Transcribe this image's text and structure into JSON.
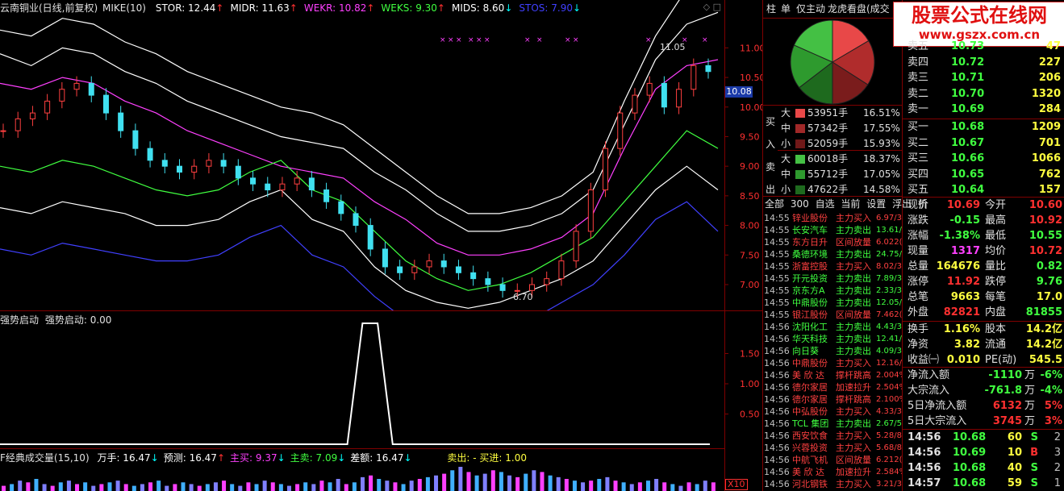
{
  "main_chart": {
    "stock": "云南铜业(日线,前复权)",
    "indicator": "MIKE(10)",
    "legend": [
      {
        "label": "STOR: 12.44",
        "color": "#ffffff",
        "arrow": "↑",
        "arrow_color": "#ff3030"
      },
      {
        "label": "MIDR: 11.63",
        "color": "#ffffff",
        "arrow": "↑",
        "arrow_color": "#ff3030"
      },
      {
        "label": "WEKR: 10.82",
        "color": "#ff40ff",
        "arrow": "↑",
        "arrow_color": "#ff3030"
      },
      {
        "label": "WEKS: 9.30",
        "color": "#40ff40",
        "arrow": "↑",
        "arrow_color": "#ff3030"
      },
      {
        "label": "MIDS: 8.60",
        "color": "#ffffff",
        "arrow": "↓",
        "arrow_color": "#00ffff"
      },
      {
        "label": "STOS: 7.90",
        "color": "#4040ff",
        "arrow": "↓",
        "arrow_color": "#00ffff"
      }
    ],
    "y_ticks": [
      "11.00",
      "10.50",
      "10.00",
      "9.50",
      "9.00",
      "8.50",
      "8.00",
      "7.50",
      "7.00"
    ],
    "current_price_tag": "10.08",
    "high_label": "11.05",
    "low_label": "6.70"
  },
  "chart_data": [
    {
      "type": "line",
      "title": "",
      "series": [
        {
          "name": "STOR",
          "values": [
            11.3,
            11.2,
            11.5,
            11.4,
            11.1,
            10.9,
            10.6,
            10.4,
            10.2,
            10.0,
            9.9,
            9.7,
            9.3,
            8.9,
            8.5,
            8.2,
            8.2,
            8.3,
            8.5,
            8.9,
            10.1,
            11.2,
            12.0,
            12.4
          ]
        },
        {
          "name": "MIDR",
          "values": [
            10.9,
            10.7,
            11.0,
            10.9,
            10.6,
            10.4,
            10.1,
            9.9,
            9.7,
            9.5,
            9.4,
            9.3,
            8.9,
            8.6,
            8.2,
            7.9,
            7.9,
            8.0,
            8.2,
            8.6,
            9.7,
            10.8,
            11.4,
            11.6
          ]
        },
        {
          "name": "WEKR",
          "values": [
            10.4,
            10.3,
            10.5,
            10.4,
            10.1,
            9.9,
            9.6,
            9.4,
            9.2,
            9.0,
            8.9,
            8.8,
            8.4,
            8.1,
            7.7,
            7.5,
            7.5,
            7.6,
            7.8,
            8.2,
            9.3,
            10.3,
            10.7,
            10.8
          ]
        },
        {
          "name": "WEKS",
          "values": [
            9.0,
            8.9,
            9.1,
            9.0,
            8.8,
            8.6,
            8.5,
            8.6,
            8.9,
            9.1,
            8.6,
            8.4,
            7.9,
            7.4,
            7.1,
            6.9,
            7.0,
            7.2,
            7.5,
            7.8,
            8.4,
            9.0,
            9.6,
            9.3
          ]
        },
        {
          "name": "MIDS",
          "values": [
            8.3,
            8.2,
            8.4,
            8.3,
            8.2,
            8.0,
            8.0,
            8.1,
            8.4,
            8.6,
            8.1,
            7.9,
            7.3,
            6.9,
            6.7,
            6.6,
            6.7,
            6.9,
            7.1,
            7.4,
            8.0,
            8.6,
            9.0,
            8.6
          ]
        },
        {
          "name": "STOS",
          "values": [
            7.6,
            7.5,
            7.7,
            7.6,
            7.5,
            7.4,
            7.4,
            7.5,
            7.8,
            8.0,
            7.5,
            7.3,
            6.8,
            6.4,
            6.2,
            6.1,
            6.2,
            6.4,
            6.7,
            7.0,
            7.5,
            8.1,
            8.4,
            7.9
          ]
        }
      ],
      "candles": [
        9.6,
        9.8,
        9.9,
        10.1,
        10.3,
        10.4,
        10.2,
        9.9,
        9.6,
        9.3,
        9.1,
        9.0,
        8.9,
        9.0,
        9.1,
        9.0,
        8.8,
        8.7,
        8.6,
        8.7,
        8.8,
        8.6,
        8.4,
        8.2,
        8.0,
        7.6,
        7.3,
        7.2,
        7.3,
        7.4,
        7.3,
        7.2,
        7.1,
        7.0,
        6.9,
        6.9,
        7.0,
        7.1,
        7.4,
        7.9,
        8.6,
        9.3,
        9.9,
        10.2,
        10.4,
        10.0,
        10.3,
        10.7,
        10.6
      ],
      "ylim": [
        6.7,
        11.4
      ]
    },
    {
      "type": "line",
      "title": "",
      "series": [
        {
          "name": "强势启动",
          "values": [
            0,
            0,
            0,
            0,
            0,
            0,
            0,
            0,
            0,
            0,
            0,
            0,
            0,
            0,
            0,
            0,
            0,
            0,
            0,
            0,
            0,
            0,
            0,
            0,
            2,
            2,
            0,
            0,
            0,
            0,
            0,
            0,
            0,
            0,
            0,
            0,
            0,
            0,
            0,
            0,
            0,
            0,
            0,
            0,
            0,
            0,
            0,
            0
          ]
        }
      ],
      "ylim": [
        0,
        2.0
      ]
    },
    {
      "type": "bar",
      "title": "",
      "series": [
        {
          "name": "万手",
          "values": [
            3,
            4,
            6,
            5,
            7,
            4,
            3,
            5,
            6,
            4,
            5,
            3,
            4,
            5,
            6,
            4,
            3,
            4,
            5,
            6,
            3,
            4,
            5,
            4,
            3,
            4,
            5,
            6,
            4,
            3,
            5,
            4,
            6,
            5,
            4,
            3,
            4,
            5,
            4,
            6,
            5,
            7,
            4,
            5,
            8,
            9,
            7,
            6,
            5,
            4,
            6,
            7,
            8,
            9,
            10,
            12,
            14,
            11,
            9,
            10,
            12,
            11,
            9,
            8,
            10,
            12,
            11,
            9,
            8,
            7,
            6,
            5,
            6,
            7,
            8,
            6,
            5,
            4,
            5,
            6,
            7,
            5,
            4,
            3,
            5,
            4,
            6,
            5
          ]
        }
      ]
    }
  ],
  "indicator_panel": {
    "title": "强势启动",
    "value_label": "强势启动: 0.00",
    "y_ticks": [
      "1.50",
      "1.00",
      "0.50"
    ]
  },
  "volume_panel": {
    "title": "F经典成交量(15,10)",
    "items": [
      {
        "label": "万手: 16.47",
        "color": "#ffffff",
        "arrow": "↓",
        "arrow_color": "#00ffff"
      },
      {
        "label": "预测: 16.47",
        "color": "#ffffff",
        "arrow": "↑",
        "arrow_color": "#ff3030"
      },
      {
        "label": "主买: 9.37",
        "color": "#ff40ff",
        "arrow": "↓",
        "arrow_color": "#00ffff"
      },
      {
        "label": "主卖: 7.09",
        "color": "#40ff40",
        "arrow": "↓",
        "arrow_color": "#00ffff"
      },
      {
        "label": "差额: 16.47",
        "color": "#ffffff",
        "arrow": "↓",
        "arrow_color": "#00ffff"
      }
    ],
    "sell_buy": "卖出: -  买进: 1.00",
    "scale": "X10"
  },
  "right_tabs": [
    "柱",
    "单",
    "仅主动",
    "龙虎看盘(成交"
  ],
  "watermark": {
    "line1": "股票公式在线网",
    "line2": "www.gszx.com.cn"
  },
  "pie": {
    "slices": [
      {
        "name": "买大",
        "value": 16.51,
        "color": "#e84848"
      },
      {
        "name": "买中",
        "value": 17.55,
        "color": "#b02c2c"
      },
      {
        "name": "买小",
        "value": 15.93,
        "color": "#7a1c1c"
      },
      {
        "name": "卖小",
        "value": 14.58,
        "color": "#1e6a1e"
      },
      {
        "name": "卖中",
        "value": 17.05,
        "color": "#2e9a2e"
      },
      {
        "name": "卖大",
        "value": 18.37,
        "color": "#44c044"
      }
    ]
  },
  "flow": {
    "buy_label": [
      "买",
      "入"
    ],
    "sell_label": [
      "卖",
      "出"
    ],
    "buy": [
      {
        "size": "大",
        "volume": "53951手",
        "pct": "16.51%",
        "color": "#e84848"
      },
      {
        "size": "中",
        "volume": "57342手",
        "pct": "17.55%",
        "color": "#a02828"
      },
      {
        "size": "小",
        "volume": "52059手",
        "pct": "15.93%",
        "color": "#701818"
      }
    ],
    "sell": [
      {
        "size": "大",
        "volume": "60018手",
        "pct": "18.37%",
        "color": "#44c044"
      },
      {
        "size": "中",
        "volume": "55712手",
        "pct": "17.05%",
        "color": "#2e9a2e"
      },
      {
        "size": "小",
        "volume": "47622手",
        "pct": "14.58%",
        "color": "#1e6a1e"
      }
    ]
  },
  "radar_tabs": [
    "全部",
    "300",
    "自选",
    "当前",
    "设置",
    "浮出",
    "折"
  ],
  "radar": [
    {
      "time": "14:55",
      "name": "锌业股份",
      "action": "主力买入",
      "value": "6.97/3",
      "buy": true
    },
    {
      "time": "14:55",
      "name": "长安汽车",
      "action": "主力卖出",
      "value": "13.61/",
      "buy": false
    },
    {
      "time": "14:55",
      "name": "东方日升",
      "action": "区间放量",
      "value": "6.022(",
      "buy": true
    },
    {
      "time": "14:55",
      "name": "桑德环境",
      "action": "主力卖出",
      "value": "24.75/",
      "buy": false
    },
    {
      "time": "14:55",
      "name": "浙富控股",
      "action": "主力买入",
      "value": "8.02/3",
      "buy": true
    },
    {
      "time": "14:55",
      "name": "开元投资",
      "action": "主力卖出",
      "value": "7.89/3",
      "buy": false
    },
    {
      "time": "14:55",
      "name": "京东方A",
      "action": "主力卖出",
      "value": "2.33/3",
      "buy": false
    },
    {
      "time": "14:55",
      "name": "中鼎股份",
      "action": "主力卖出",
      "value": "12.05/",
      "buy": false
    },
    {
      "time": "14:55",
      "name": "银江股份",
      "action": "区间放量",
      "value": "7.462(",
      "buy": true
    },
    {
      "time": "14:56",
      "name": "沈阳化工",
      "action": "主力卖出",
      "value": "4.43/3",
      "buy": false
    },
    {
      "time": "14:56",
      "name": "华天科技",
      "action": "主力卖出",
      "value": "12.41/",
      "buy": false
    },
    {
      "time": "14:56",
      "name": "向日葵",
      "action": "主力卖出",
      "value": "4.09/3",
      "buy": false
    },
    {
      "time": "14:56",
      "name": "中鼎股份",
      "action": "主力买入",
      "value": "12.16/",
      "buy": true
    },
    {
      "time": "14:56",
      "name": "美 欣 达",
      "action": "撑杆跳高",
      "value": "2.004%",
      "buy": true
    },
    {
      "time": "14:56",
      "name": "德尔家居",
      "action": "加速拉升",
      "value": "2.504%",
      "buy": true
    },
    {
      "time": "14:56",
      "name": "德尔家居",
      "action": "撑杆跳高",
      "value": "2.100%",
      "buy": true
    },
    {
      "time": "14:56",
      "name": "中弘股份",
      "action": "主力买入",
      "value": "4.33/3",
      "buy": true
    },
    {
      "time": "14:56",
      "name": "TCL 集团",
      "action": "主力卖出",
      "value": "2.67/5",
      "buy": false
    },
    {
      "time": "14:56",
      "name": "西安饮食",
      "action": "主力买入",
      "value": "5.28/8",
      "buy": true
    },
    {
      "time": "14:56",
      "name": "兴蓉投资",
      "action": "主力买入",
      "value": "5.68/8",
      "buy": true
    },
    {
      "time": "14:56",
      "name": "中航飞机",
      "action": "区间放量",
      "value": "6.212(",
      "buy": true
    },
    {
      "time": "14:56",
      "name": "美 欣 达",
      "action": "加速拉升",
      "value": "2.584%",
      "buy": true
    },
    {
      "time": "14:56",
      "name": "河北钢铁",
      "action": "主力买入",
      "value": "3.21/3",
      "buy": true
    }
  ],
  "order_book": {
    "asks": [
      {
        "label": "卖五",
        "price": "10.73",
        "vol": "47"
      },
      {
        "label": "卖四",
        "price": "10.72",
        "vol": "227"
      },
      {
        "label": "卖三",
        "price": "10.71",
        "vol": "206"
      },
      {
        "label": "卖二",
        "price": "10.70",
        "vol": "1320"
      },
      {
        "label": "卖一",
        "price": "10.69",
        "vol": "284"
      }
    ],
    "bids": [
      {
        "label": "买一",
        "price": "10.68",
        "vol": "1209"
      },
      {
        "label": "买二",
        "price": "10.67",
        "vol": "701"
      },
      {
        "label": "买三",
        "price": "10.66",
        "vol": "1066"
      },
      {
        "label": "买四",
        "price": "10.65",
        "vol": "762"
      },
      {
        "label": "买五",
        "price": "10.64",
        "vol": "157"
      }
    ]
  },
  "quote": [
    [
      {
        "l": "现价",
        "v": "10.69",
        "c": "#ff3030"
      },
      {
        "l": "今开",
        "v": "10.60",
        "c": "#ff3030"
      }
    ],
    [
      {
        "l": "涨跌",
        "v": "-0.15",
        "c": "#40ff40"
      },
      {
        "l": "最高",
        "v": "10.92",
        "c": "#ff3030"
      }
    ],
    [
      {
        "l": "涨幅",
        "v": "-1.38%",
        "c": "#40ff40"
      },
      {
        "l": "最低",
        "v": "10.55",
        "c": "#40ff40"
      }
    ],
    [
      {
        "l": "现量",
        "v": "1317",
        "c": "#ff40ff"
      },
      {
        "l": "均价",
        "v": "10.72",
        "c": "#ff3030"
      }
    ],
    [
      {
        "l": "总量",
        "v": "164676",
        "c": "#ffff40"
      },
      {
        "l": "量比",
        "v": "0.82",
        "c": "#40ff40"
      }
    ],
    [
      {
        "l": "涨停",
        "v": "11.92",
        "c": "#ff3030"
      },
      {
        "l": "跌停",
        "v": "9.76",
        "c": "#40ff40"
      }
    ],
    [
      {
        "l": "总笔",
        "v": "9663",
        "c": "#ffff40"
      },
      {
        "l": "每笔",
        "v": "17.0",
        "c": "#ffff40"
      }
    ],
    [
      {
        "l": "外盘",
        "v": "82821",
        "c": "#ff3030"
      },
      {
        "l": "内盘",
        "v": "81855",
        "c": "#40ff40"
      }
    ]
  ],
  "quote2": [
    [
      {
        "l": "换手",
        "v": "1.16%",
        "c": "#ffff40"
      },
      {
        "l": "股本",
        "v": "14.2亿",
        "c": "#ffff40"
      }
    ],
    [
      {
        "l": "净资",
        "v": "3.82",
        "c": "#ffff40"
      },
      {
        "l": "流通",
        "v": "14.2亿",
        "c": "#ffff40"
      }
    ],
    [
      {
        "l": "收益㈠",
        "v": "0.010",
        "c": "#ffff40"
      },
      {
        "l": "PE(动)",
        "v": "545.5",
        "c": "#ffff40"
      }
    ]
  ],
  "funds": [
    {
      "label": "净流入额",
      "val": "-1110",
      "unit": "万",
      "pct": "-6%",
      "c": "#40ff40"
    },
    {
      "label": "大宗流入",
      "val": "-761.8",
      "unit": "万",
      "pct": "-4%",
      "c": "#40ff40"
    },
    {
      "label": "5日净流入额",
      "val": "6132",
      "unit": "万",
      "pct": "5%",
      "c": "#ff3030"
    },
    {
      "label": "5日大宗流入",
      "val": "3745",
      "unit": "万",
      "pct": "3%",
      "c": "#ff3030"
    }
  ],
  "ticks": [
    {
      "time": "14:56",
      "price": "10.68",
      "vol": "60",
      "side": "S",
      "n": "2",
      "sc": "#40ff40"
    },
    {
      "time": "14:56",
      "price": "10.69",
      "vol": "10",
      "side": "B",
      "n": "3",
      "sc": "#ff3030"
    },
    {
      "time": "14:56",
      "price": "10.68",
      "vol": "40",
      "side": "S",
      "n": "2",
      "sc": "#40ff40"
    },
    {
      "time": "14:57",
      "price": "10.68",
      "vol": "59",
      "side": "S",
      "n": "1",
      "sc": "#40ff40"
    }
  ]
}
